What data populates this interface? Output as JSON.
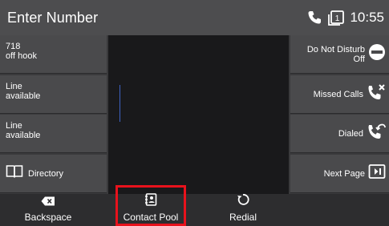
{
  "titlebar": {
    "title": "Enter Number",
    "time": "10:55",
    "line_badge": "1"
  },
  "left_keys": [
    {
      "line1": "718",
      "line2": "off hook"
    },
    {
      "line1": "Line",
      "line2": "available"
    },
    {
      "line1": "Line",
      "line2": "available"
    },
    {
      "label": "Directory"
    }
  ],
  "right_keys": [
    {
      "line1": "Do Not Disturb",
      "line2": "Off"
    },
    {
      "line1": "Missed Calls"
    },
    {
      "line1": "Dialed"
    },
    {
      "line1": "Next Page"
    }
  ],
  "softkeys": [
    {
      "label": "Backspace"
    },
    {
      "label": "Contact Pool"
    },
    {
      "label": "Redial"
    }
  ],
  "colors": {
    "titlebar": "#4d4d4f",
    "key_bg": "#4a4a4c",
    "center_bg": "#19191b",
    "cursor": "#3e63c5",
    "highlight": "#e8121c"
  }
}
